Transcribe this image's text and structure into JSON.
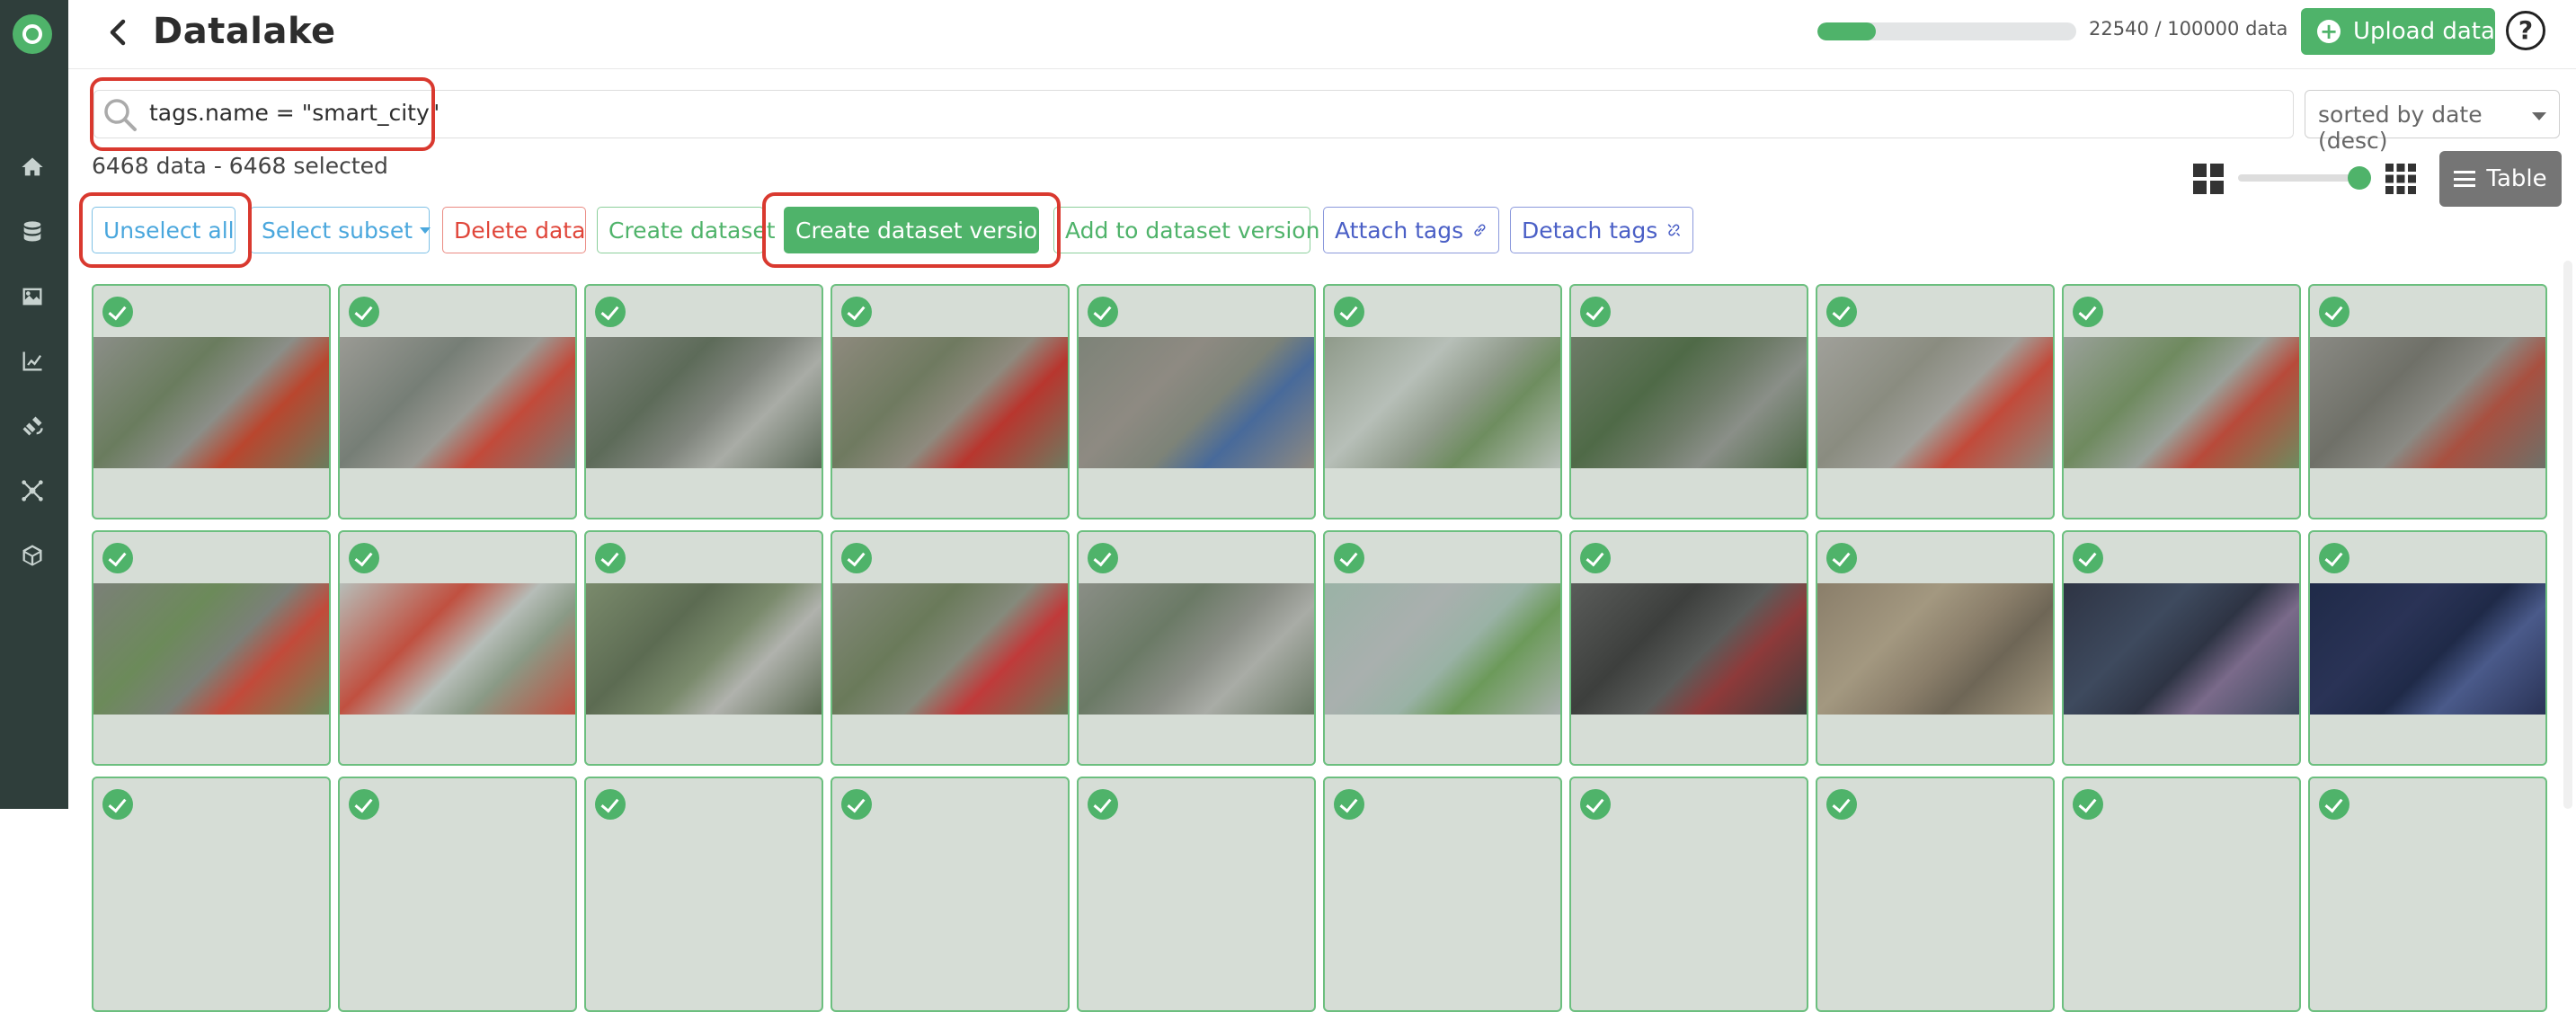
{
  "app": {
    "title": "Datalake"
  },
  "sidebar": {
    "icons": [
      "home-icon",
      "database-icon",
      "image-icon",
      "chart-icon",
      "satellite-icon",
      "network-icon",
      "cube-icon"
    ]
  },
  "header": {
    "usage_text": "22540 / 100000 data",
    "usage_fraction": 0.2254,
    "upload_label": "Upload data",
    "help_label": "?"
  },
  "search": {
    "query": "tags.name = \"smart_city\"",
    "sort_value": "sorted by date (desc)"
  },
  "selection": {
    "count_text": "6468 data - 6468 selected"
  },
  "view": {
    "table_label": "Table"
  },
  "actions": {
    "unselect_all": "Unselect all",
    "select_subset": "Select subset",
    "delete_data": "Delete data",
    "create_dataset": "Create dataset",
    "create_dataset_version": "Create dataset version",
    "add_to_dataset_version": "Add to dataset version",
    "attach_tags": "Attach tags",
    "detach_tags": "Detach tags"
  },
  "colors": {
    "brand_green": "#4fb36a",
    "sidebar_bg": "#2f3e3b",
    "highlight_red": "#d9392f"
  },
  "grid": {
    "rows_visible": 3,
    "columns": 10,
    "thumbnails": [
      {
        "scene": "aerial parking lot with red/white building",
        "selected": true
      },
      {
        "scene": "aerial street with parked cars",
        "selected": true
      },
      {
        "scene": "aerial parking lot with trucks",
        "selected": true
      },
      {
        "scene": "aerial lot with red truck",
        "selected": true
      },
      {
        "scene": "aerial truck depot",
        "selected": true
      },
      {
        "scene": "aerial river and trees",
        "selected": true
      },
      {
        "scene": "aerial road and trees",
        "selected": true
      },
      {
        "scene": "aerial buildings and lot",
        "selected": true
      },
      {
        "scene": "aerial open field with buildings",
        "selected": true
      },
      {
        "scene": "aerial trucks lot",
        "selected": true
      },
      {
        "scene": "aerial city block",
        "selected": true
      },
      {
        "scene": "aerial hazy landscape",
        "selected": true
      },
      {
        "scene": "aerial trucks near field",
        "selected": true
      },
      {
        "scene": "aerial red trucks lot",
        "selected": true
      },
      {
        "scene": "aerial lot with containers",
        "selected": true
      },
      {
        "scene": "aerial riverside promenade",
        "selected": true
      },
      {
        "scene": "aerial square with crowd",
        "selected": true
      },
      {
        "scene": "aerial plaza dancers",
        "selected": true
      },
      {
        "scene": "aerial night square",
        "selected": true
      },
      {
        "scene": "aerial night plaza",
        "selected": true
      }
    ]
  }
}
